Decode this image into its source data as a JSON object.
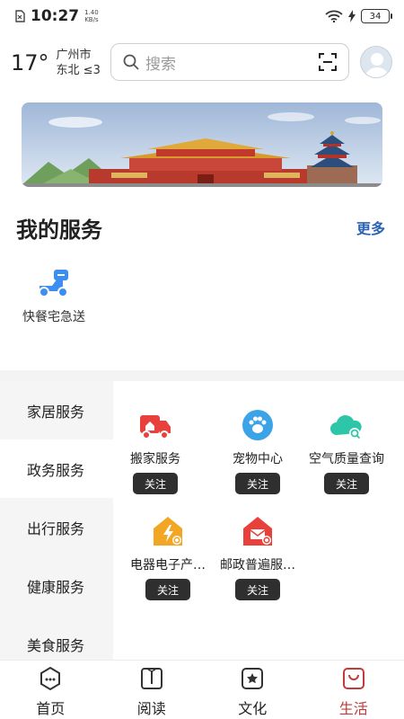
{
  "status_bar": {
    "time": "10:27",
    "net_speed_value": "1.40",
    "net_speed_unit": "KB/s",
    "battery": "34"
  },
  "header": {
    "temperature": "17°",
    "city": "广州市",
    "wind": "东北 ≤3",
    "search_placeholder": "搜索"
  },
  "services": {
    "title": "我的服务",
    "more": "更多",
    "items": [
      {
        "label": "快餐宅急送",
        "icon": "scooter-icon"
      }
    ]
  },
  "categories": [
    {
      "label": "家居服务",
      "active": false
    },
    {
      "label": "政务服务",
      "active": true
    },
    {
      "label": "出行服务",
      "active": false
    },
    {
      "label": "健康服务",
      "active": false
    },
    {
      "label": "美食服务",
      "active": false
    }
  ],
  "tiles": [
    {
      "label": "搬家服务",
      "icon": "moving-truck-icon",
      "color": "#e8413c",
      "follow": "关注"
    },
    {
      "label": "宠物中心",
      "icon": "paw-icon",
      "color": "#3ba3e8",
      "follow": "关注"
    },
    {
      "label": "空气质量查询",
      "icon": "cloud-search-icon",
      "color": "#2dc6a8",
      "follow": "关注"
    },
    {
      "label": "电器电子产…",
      "icon": "lightning-house-icon",
      "color": "#f2a623",
      "follow": "关注"
    },
    {
      "label": "邮政普遍服…",
      "icon": "mail-house-icon",
      "color": "#e8413c",
      "follow": "关注"
    }
  ],
  "tabs": [
    {
      "label": "首页",
      "icon": "home-icon",
      "active": false
    },
    {
      "label": "阅读",
      "icon": "book-icon",
      "active": false
    },
    {
      "label": "文化",
      "icon": "culture-icon",
      "active": false
    },
    {
      "label": "生活",
      "icon": "life-bag-icon",
      "active": true
    }
  ],
  "colors": {
    "accent": "#c23b3b",
    "link": "#2b63b5"
  }
}
